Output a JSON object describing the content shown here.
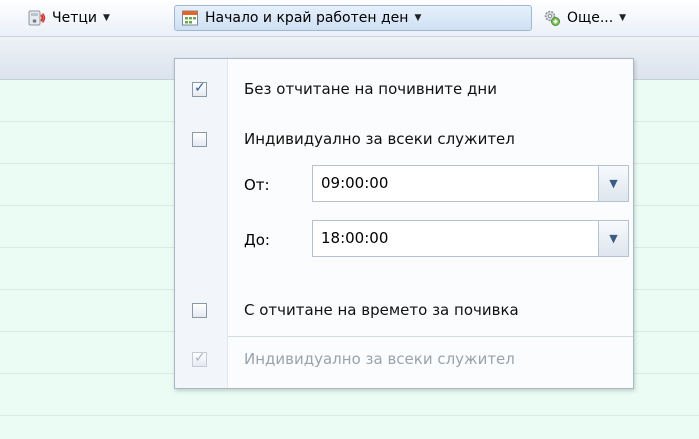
{
  "toolbar": {
    "readers_label": "Четци",
    "workday_label": "Начало и край работен ден",
    "more_label": "Още..."
  },
  "menu": {
    "item_exclude_rest_days": {
      "label": "Без отчитане на почивните дни",
      "checked": true,
      "enabled": true
    },
    "item_individual_1": {
      "label": "Индивидуално за всеки служител",
      "checked": false,
      "enabled": true
    },
    "from": {
      "label": "От:",
      "value": "09:00:00"
    },
    "to": {
      "label": "До:",
      "value": "18:00:00"
    },
    "item_rest_time": {
      "label": "С отчитане на времето за почивка",
      "checked": false,
      "enabled": true
    },
    "item_individual_2": {
      "label": "Индивидуално за всеки служител",
      "checked": true,
      "enabled": false
    }
  },
  "colors": {
    "menu_background": "#f2f5f9",
    "grid_row": "#eafcf4",
    "accent": "#2e5f9c"
  }
}
